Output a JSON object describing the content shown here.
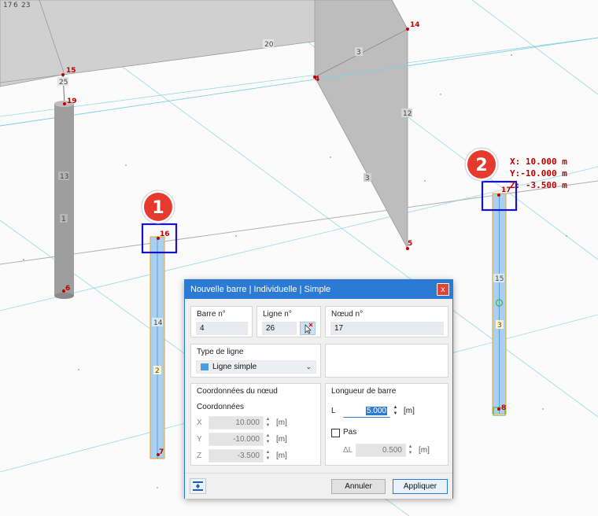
{
  "viewport": {
    "node_labels": {
      "n17": "17",
      "n6top": "6",
      "n23": "23",
      "n14": "14",
      "n15": "15",
      "n19": "19",
      "n4": "4",
      "n16": "16",
      "n17b": "17",
      "n5": "5",
      "n6": "6",
      "n7": "7",
      "n8": "8"
    },
    "member_labels": {
      "m20": "20",
      "m25": "25",
      "m3a": "3",
      "m12": "12",
      "m13": "13",
      "m1": "1",
      "m3b": "3",
      "m14": "14",
      "m2": "2",
      "m15": "15",
      "m3c": "3"
    },
    "coordinate_readout": {
      "x": "X: 10.000 m",
      "y": "Y:-10.000 m",
      "z": "Z: -3.500 m"
    },
    "badges": {
      "badge1": "1",
      "badge2": "2"
    }
  },
  "dialog": {
    "title": "Nouvelle barre | Individuelle | Simple",
    "close_label": "x",
    "member_no": {
      "label": "Barre n°",
      "value": "4"
    },
    "line_no": {
      "label": "Ligne n°",
      "value": "26"
    },
    "node_no": {
      "label": "Nœud n°",
      "value": "17"
    },
    "line_type": {
      "label": "Type de ligne",
      "value": "Ligne simple",
      "swatch_color": "#4a9de0"
    },
    "node_coords": {
      "section_label": "Coordonnées du nœud",
      "sub_label": "Coordonnées",
      "x": {
        "axis": "X",
        "value": "10.000",
        "unit": "[m]"
      },
      "y": {
        "axis": "Y",
        "value": "-10.000",
        "unit": "[m]"
      },
      "z": {
        "axis": "Z",
        "value": "-3.500",
        "unit": "[m]"
      }
    },
    "member_length": {
      "section_label": "Longueur de barre",
      "l": {
        "axis": "L",
        "value": "5.000",
        "unit": "[m]"
      },
      "step": {
        "label": "Pas",
        "checked": false
      },
      "dl": {
        "axis": "ΔL",
        "value": "0.500",
        "unit": "[m]"
      }
    },
    "buttons": {
      "cancel": "Annuler",
      "apply": "Appliquer"
    }
  }
}
